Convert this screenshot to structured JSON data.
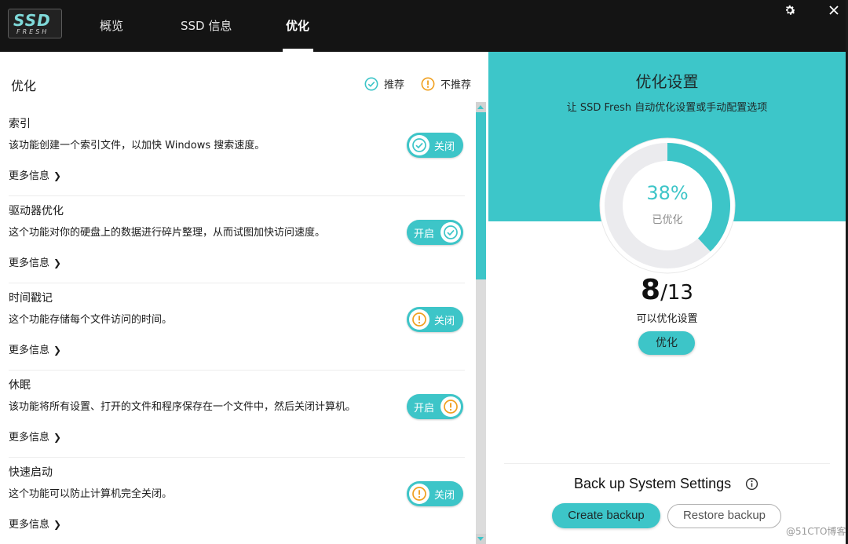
{
  "app": {
    "logo_main": "SSD",
    "logo_sub": "FRESH"
  },
  "tabs": [
    {
      "label": "概览"
    },
    {
      "label": "SSD 信息"
    },
    {
      "label": "优化",
      "active": true
    }
  ],
  "window_icons": [
    "gear-icon",
    "close-icon"
  ],
  "left": {
    "title": "优化",
    "legend": {
      "recommended": "推荐",
      "not_recommended": "不推荐"
    },
    "items": [
      {
        "title": "索引",
        "desc": "该功能创建一个索引文件，以加快 Windows 搜索速度。",
        "more": "更多信息",
        "toggle": "关闭",
        "state": "off",
        "icon": "check-icon"
      },
      {
        "title": "驱动器优化",
        "desc": "这个功能对你的硬盘上的数据进行碎片整理，从而试图加快访问速度。",
        "more": "更多信息",
        "toggle": "开启",
        "state": "on",
        "icon": "check-icon"
      },
      {
        "title": "时间戳记",
        "desc": "这个功能存储每个文件访问的时间。",
        "more": "更多信息",
        "toggle": "关闭",
        "state": "off",
        "icon": "warning-icon"
      },
      {
        "title": "休眠",
        "desc": "该功能将所有设置、打开的文件和程序保存在一个文件中，然后关闭计算机。",
        "more": "更多信息",
        "toggle": "开启",
        "state": "on",
        "icon": "warning-icon"
      },
      {
        "title": "快速启动",
        "desc": "这个功能可以防止计算机完全关闭。",
        "more": "更多信息",
        "toggle": "关闭",
        "state": "off",
        "icon": "warning-icon"
      }
    ]
  },
  "right": {
    "title": "优化设置",
    "subtitle": "让 SSD Fresh 自动优化设置或手动配置选项",
    "percent_text": "38%",
    "percent_value": 0.38,
    "percent_label": "已优化",
    "count_done": "8",
    "count_total": "/13",
    "count_label": "可以优化设置",
    "optimize_button": "优化",
    "backup_title": "Back up System Settings",
    "create_backup": "Create backup",
    "restore_backup": "Restore backup"
  },
  "colors": {
    "accent": "#3dc5c8",
    "warning": "#f0a020",
    "topbar": "#141414"
  },
  "watermark": "@51CTO博客"
}
